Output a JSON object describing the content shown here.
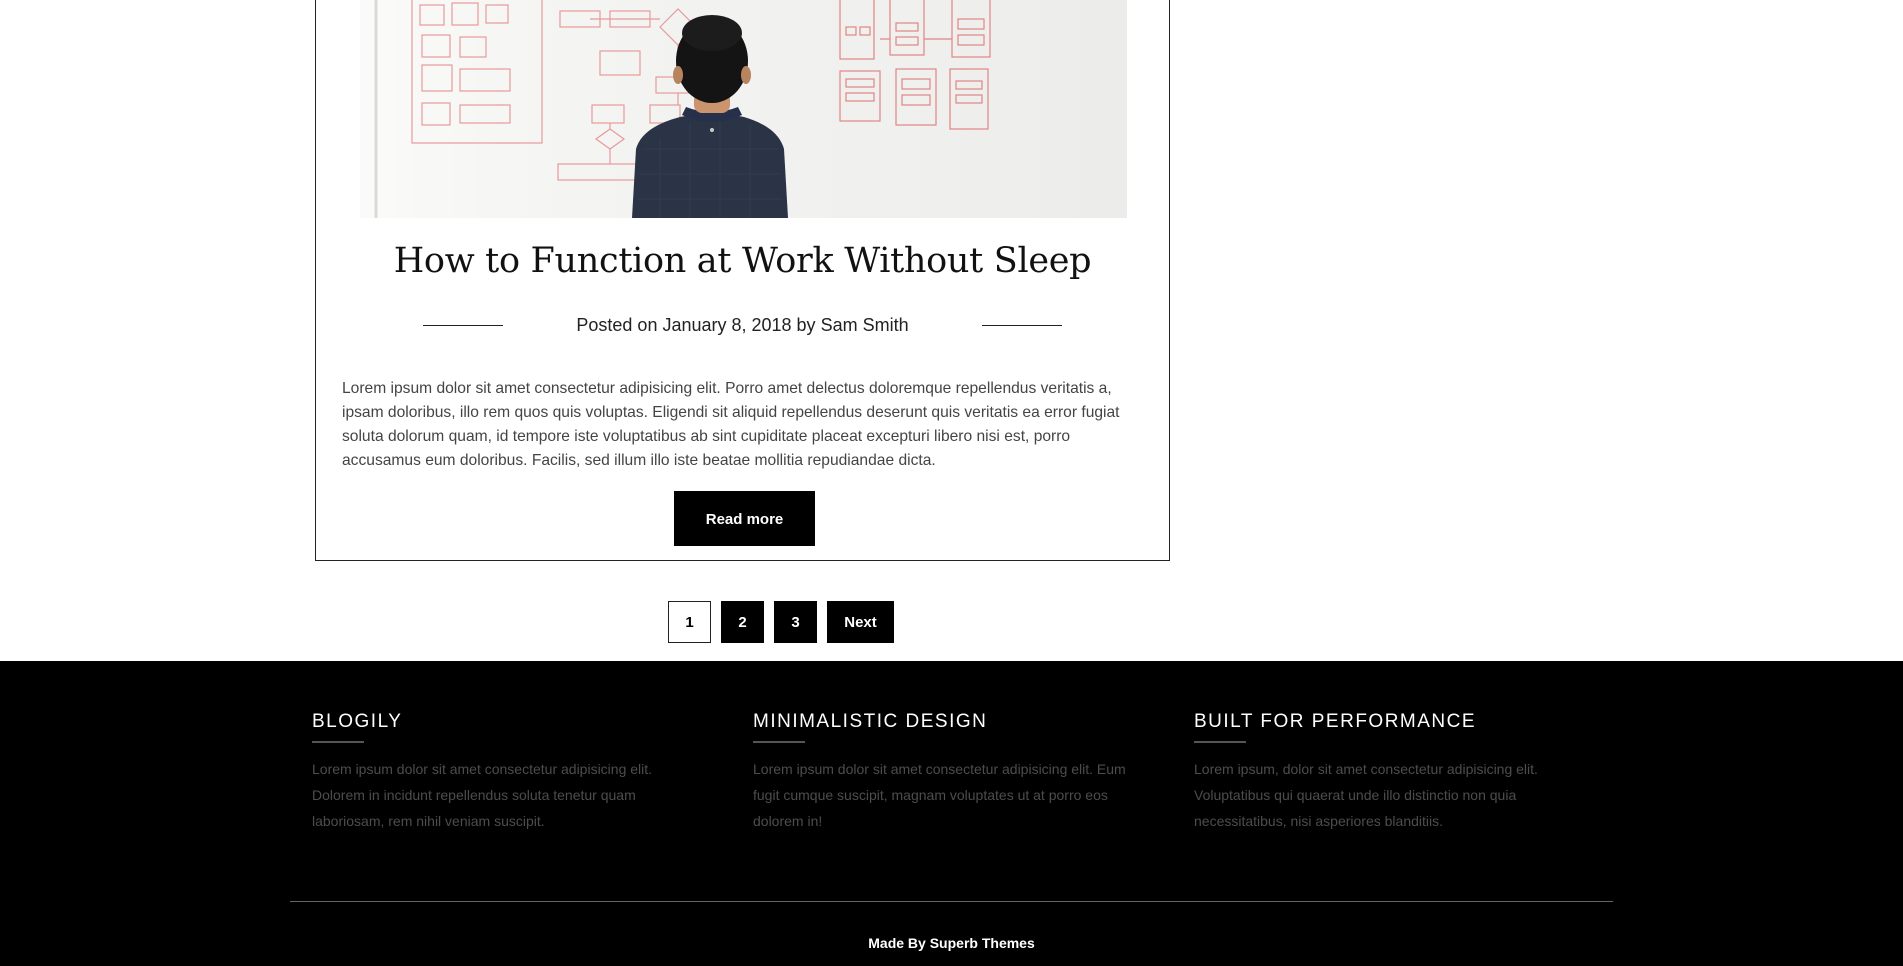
{
  "post": {
    "title": "How to Function at Work Without Sleep",
    "meta_prefix": "Posted on ",
    "date": "January 8, 2018",
    "meta_by": " by ",
    "author": "Sam Smith",
    "excerpt": "Lorem ipsum dolor sit amet consectetur adipisicing elit. Porro amet delectus doloremque repellendus veritatis a, ipsam doloribus, illo rem quos quis voluptas. Eligendi sit aliquid repellendus deserunt quis veritatis ea error fugiat soluta dolorum quam, id tempore iste voluptatibus ab sint cupiditate placeat excepturi libero nisi est, porro accusamus eum doloribus. Facilis, sed illum illo iste beatae mollitia repudiandae dicta.",
    "read_more_label": "Read more"
  },
  "pagination": {
    "pages": [
      "1",
      "2",
      "3"
    ],
    "current": "1",
    "next_label": "Next"
  },
  "footer": {
    "columns": [
      {
        "heading": "BLOGILY",
        "text": "Lorem ipsum dolor sit amet consectetur adipisicing elit. Dolorem in incidunt repellendus soluta tenetur quam laboriosam, rem nihil veniam suscipit."
      },
      {
        "heading": "MINIMALISTIC DESIGN",
        "text": "Lorem ipsum dolor sit amet consectetur adipisicing elit. Eum fugit cumque suscipit, magnam voluptates ut at porro eos dolorem in!"
      },
      {
        "heading": "BUILT FOR PERFORMANCE",
        "text": "Lorem ipsum, dolor sit amet consectetur adipisicing elit. Voluptatibus qui quaerat unde illo distinctio non quia necessitatibus, nisi asperiores blanditiis."
      }
    ],
    "credit_prefix": "Made By ",
    "credit_link": "Superb Themes"
  },
  "colors": {
    "background": "#ffffff",
    "footer_bg": "#000000",
    "button_bg": "#000000",
    "footer_text": "#4d4d4d"
  }
}
